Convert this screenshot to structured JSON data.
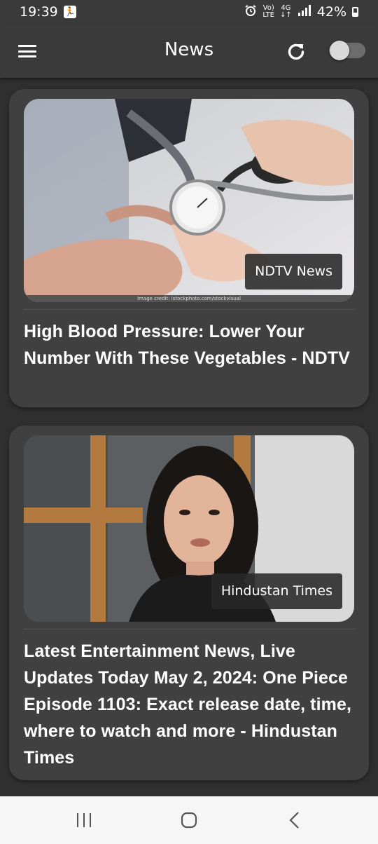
{
  "status_bar": {
    "time": "19:39",
    "network_top": "Vo)",
    "network_bottom": "LTE",
    "data_top": "4G",
    "battery": "42%"
  },
  "app_bar": {
    "title": "News",
    "menu_icon": "hamburger-menu-icon",
    "refresh_icon": "refresh-icon",
    "toggle_state": "off"
  },
  "articles": [
    {
      "source": "NDTV News",
      "title": "High Blood Pressure: Lower Your Number With These Vegetables - NDTV",
      "image_credit": "Image credit: istockphoto.com/stockvisual"
    },
    {
      "source": "Hindustan Times",
      "title": "Latest Entertainment News, Live Updates Today May 2, 2024: One Piece Episode 1103: Exact release date, time, where to watch and more - Hindustan Times"
    }
  ],
  "nav_bar": {
    "recents": "recents-icon",
    "home": "home-icon",
    "back": "back-icon"
  },
  "colors": {
    "background": "#2f2f2f",
    "card": "#404040",
    "app_bar": "#3a3a3a"
  }
}
